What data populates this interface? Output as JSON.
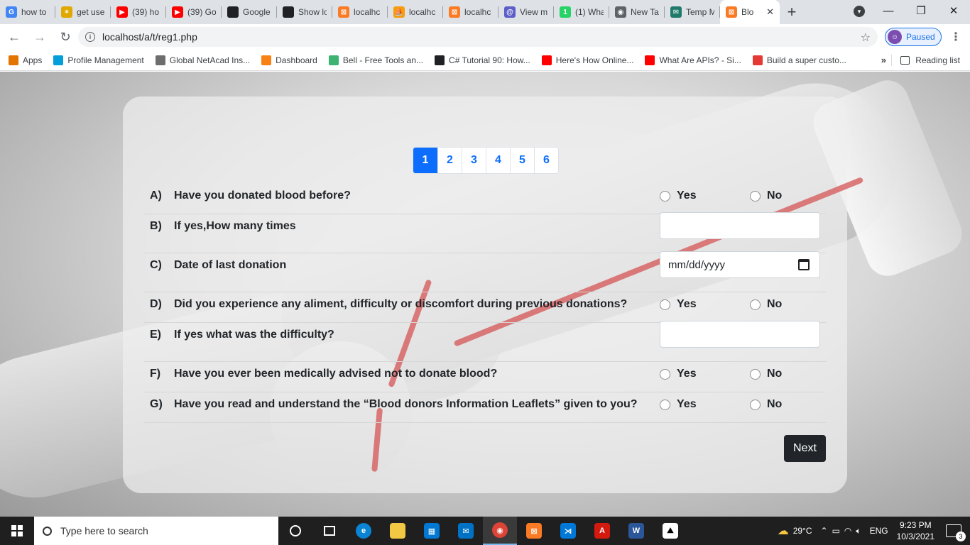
{
  "browser": {
    "tabs": [
      {
        "title": "how to",
        "icon": "google-icon",
        "color": "#4285f4",
        "glyph": "G"
      },
      {
        "title": "get use",
        "icon": "clickup-icon",
        "color": "#e0a800",
        "glyph": "✶"
      },
      {
        "title": "(39) ho",
        "icon": "youtube-icon",
        "color": "#ff0000",
        "glyph": "▶"
      },
      {
        "title": "(39) Go",
        "icon": "youtube-icon",
        "color": "#ff0000",
        "glyph": "▶"
      },
      {
        "title": "Google",
        "icon": "terminal-icon",
        "color": "#202124",
        "glyph": ""
      },
      {
        "title": "Show lo",
        "icon": "terminal-icon",
        "color": "#202124",
        "glyph": ""
      },
      {
        "title": "localhc",
        "icon": "xampp-icon",
        "color": "#fb7a24",
        "glyph": "⊠"
      },
      {
        "title": "localhc",
        "icon": "phpmyadmin-icon",
        "color": "#f89c0e",
        "glyph": "⛵"
      },
      {
        "title": "localhc",
        "icon": "xampp-icon",
        "color": "#fb7a24",
        "glyph": "⊠"
      },
      {
        "title": "View m",
        "icon": "at-icon",
        "color": "#5b5fc7",
        "glyph": "@"
      },
      {
        "title": "(1) Wha",
        "icon": "whatsapp-icon",
        "color": "#25d366",
        "glyph": "1"
      },
      {
        "title": "New Ta",
        "icon": "chrome-icon",
        "color": "#5f6368",
        "glyph": "◉"
      },
      {
        "title": "Temp M",
        "icon": "tempmail-icon",
        "color": "#1f7a6a",
        "glyph": "✉"
      },
      {
        "title": "Blo",
        "icon": "xampp-icon",
        "color": "#fb7a24",
        "glyph": "⊠",
        "active": true
      }
    ],
    "new_tab_glyph": "+",
    "window_controls": {
      "minimize": "—",
      "restore": "❐",
      "close": "✕"
    },
    "nav": {
      "back": "←",
      "forward": "→",
      "reload": "↻"
    },
    "url": "localhost/a/t/reg1.php",
    "profile_label": "Paused",
    "bookmarks": [
      {
        "label": "Apps",
        "icon": "apps-grid-icon",
        "color": "#e37400"
      },
      {
        "label": "Profile Management",
        "icon": "cisco-icon",
        "color": "#049fd9"
      },
      {
        "label": "Global NetAcad Ins...",
        "icon": "cisco-icon",
        "color": "#6d6d6d"
      },
      {
        "label": "Dashboard",
        "icon": "moodle-icon",
        "color": "#f98012"
      },
      {
        "label": "Bell - Free Tools an...",
        "icon": "vuetify-icon",
        "color": "#3cb371"
      },
      {
        "label": "C# Tutorial 90: How...",
        "icon": "globe-icon",
        "color": "#202124"
      },
      {
        "label": "Here's How Online...",
        "icon": "youtube-icon",
        "color": "#ff0000"
      },
      {
        "label": "What Are APIs? - Si...",
        "icon": "youtube-icon",
        "color": "#ff0000"
      },
      {
        "label": "Build a super custo...",
        "icon": "sl-icon",
        "color": "#e53935"
      }
    ],
    "bookmarks_more": "»",
    "reading_list": "Reading list"
  },
  "form": {
    "pages": [
      "1",
      "2",
      "3",
      "4",
      "5",
      "6"
    ],
    "active_page": "1",
    "yes_label": "Yes",
    "no_label": "No",
    "questions": [
      {
        "letter": "A)",
        "text": "Have you donated blood before?",
        "type": "radio"
      },
      {
        "letter": "B)",
        "text": "If yes,How many times",
        "type": "text",
        "value": ""
      },
      {
        "letter": "C)",
        "text": "Date of last donation",
        "type": "date",
        "placeholder": "mm/dd/yyyy"
      },
      {
        "letter": "D)",
        "text": "Did you experience any aliment, difficulty or discomfort during previous donations?",
        "type": "radio"
      },
      {
        "letter": "E)",
        "text": "If yes what was the difficulty?",
        "type": "text",
        "value": ""
      },
      {
        "letter": "F)",
        "text": "Have you ever been medically advised not to donate blood?",
        "type": "radio"
      },
      {
        "letter": "G)",
        "text": "Have you read and understand the “Blood donors Information Leaflets” given to you?",
        "type": "radio"
      }
    ],
    "next_label": "Next"
  },
  "taskbar": {
    "search_placeholder": "Type here to search",
    "weather": "29°C",
    "language": "ENG",
    "time": "9:23 PM",
    "date": "10/3/2021",
    "notifications": "3"
  }
}
